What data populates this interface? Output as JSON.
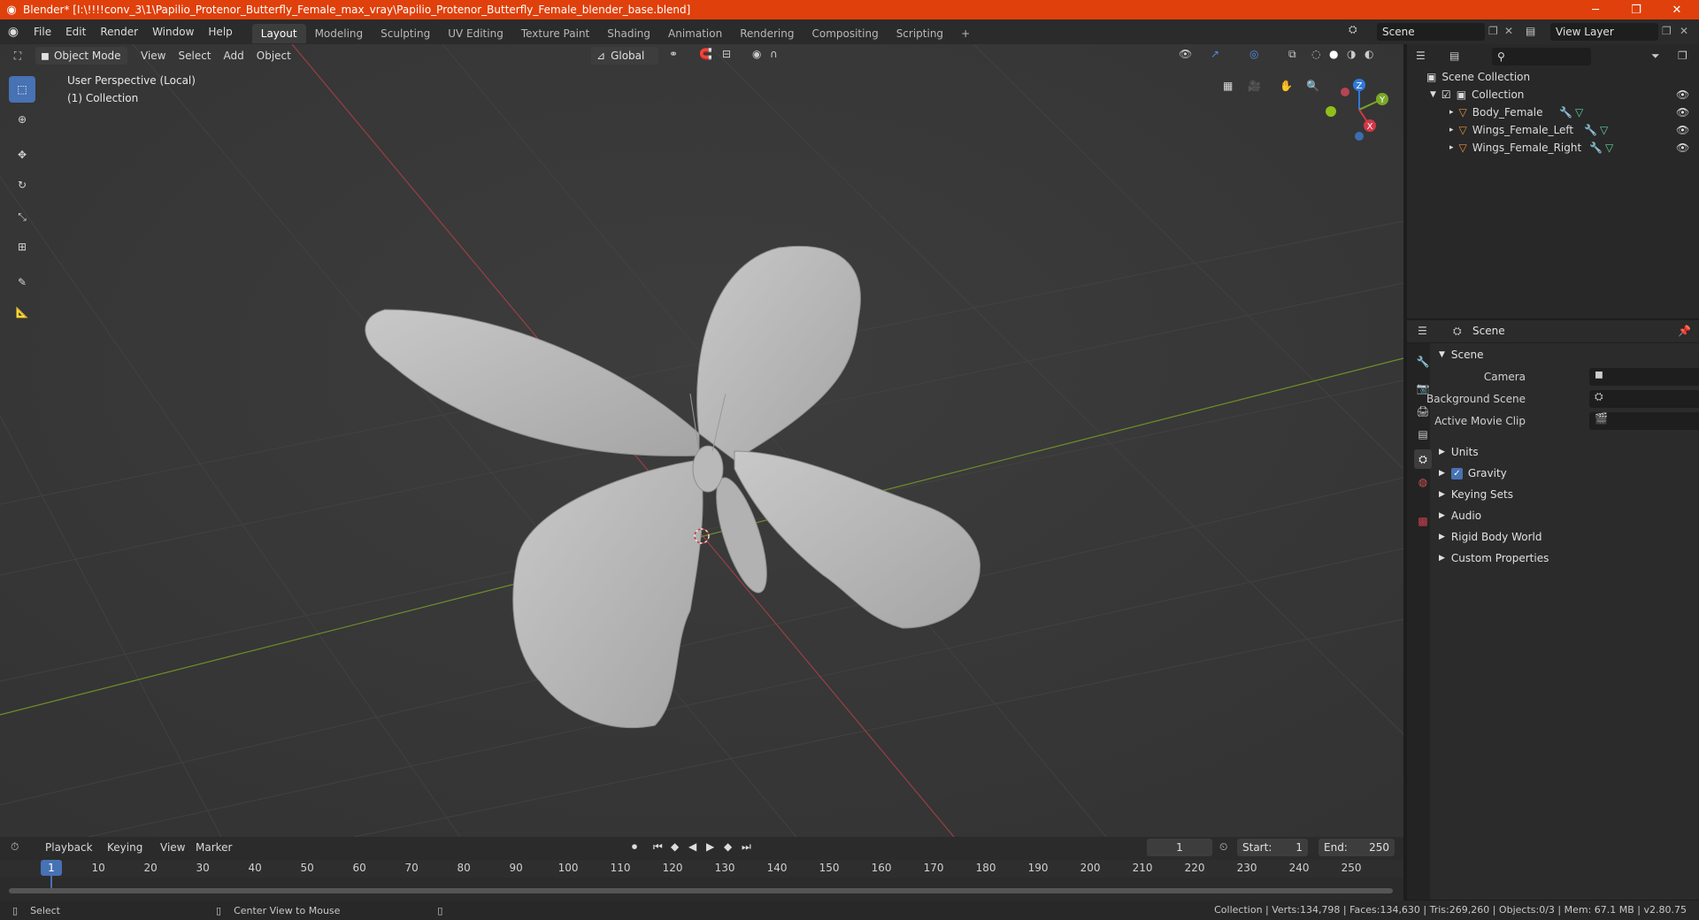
{
  "titlebar": {
    "title": "Blender* [I:\\!!!!conv_3\\1\\Papilio_Protenor_Butterfly_Female_max_vray\\Papilio_Protenor_Butterfly_Female_blender_base.blend]",
    "minimize": "─",
    "restore": "❐",
    "close": "✕",
    "color": "#e0400b"
  },
  "menubar": {
    "items": [
      "File",
      "Edit",
      "Render",
      "Window",
      "Help"
    ],
    "workspaces": [
      "Layout",
      "Modeling",
      "Sculpting",
      "UV Editing",
      "Texture Paint",
      "Shading",
      "Animation",
      "Rendering",
      "Compositing",
      "Scripting"
    ],
    "active_workspace": "Layout",
    "add_tab": "+",
    "scene": "Scene",
    "view_layer": "View Layer"
  },
  "viewport": {
    "mode": "Object Mode",
    "menus": [
      "View",
      "Select",
      "Add",
      "Object"
    ],
    "orientation": "Global",
    "overlay_line1": "User Perspective (Local)",
    "overlay_line2": "(1) Collection",
    "gizmo_axes": [
      "Z",
      "Y",
      "X"
    ],
    "x_axis_color": "#a8424b",
    "y_axis_color": "#6f8f2a"
  },
  "outliner": {
    "root": "Scene Collection",
    "collection": "Collection",
    "objects": [
      "Body_Female",
      "Wings_Female_Left",
      "Wings_Female_Right"
    ]
  },
  "properties": {
    "context": "Scene",
    "panel": "Scene",
    "fields": [
      "Camera",
      "Background Scene",
      "Active Movie Clip"
    ],
    "subpanels": [
      "Units",
      "Gravity",
      "Keying Sets",
      "Audio",
      "Rigid Body World",
      "Custom Properties"
    ],
    "gravity_checked": true
  },
  "timeline": {
    "menus": [
      "Playback",
      "Keying",
      "View",
      "Marker"
    ],
    "current_frame": "1",
    "start_label": "Start:",
    "start": "1",
    "end_label": "End:",
    "end": "250",
    "ticks": [
      "10",
      "20",
      "30",
      "40",
      "50",
      "60",
      "70",
      "80",
      "90",
      "100",
      "110",
      "120",
      "130",
      "140",
      "150",
      "160",
      "170",
      "180",
      "190",
      "200",
      "210",
      "220",
      "230",
      "240",
      "250"
    ],
    "playhead_label": "1"
  },
  "statusbar": {
    "left1": "Select",
    "left2": "Center View to Mouse",
    "stats": "Collection | Verts:134,798 | Faces:134,630 | Tris:269,260 | Objects:0/3 | Mem: 67.1 MB | v2.80.75"
  }
}
